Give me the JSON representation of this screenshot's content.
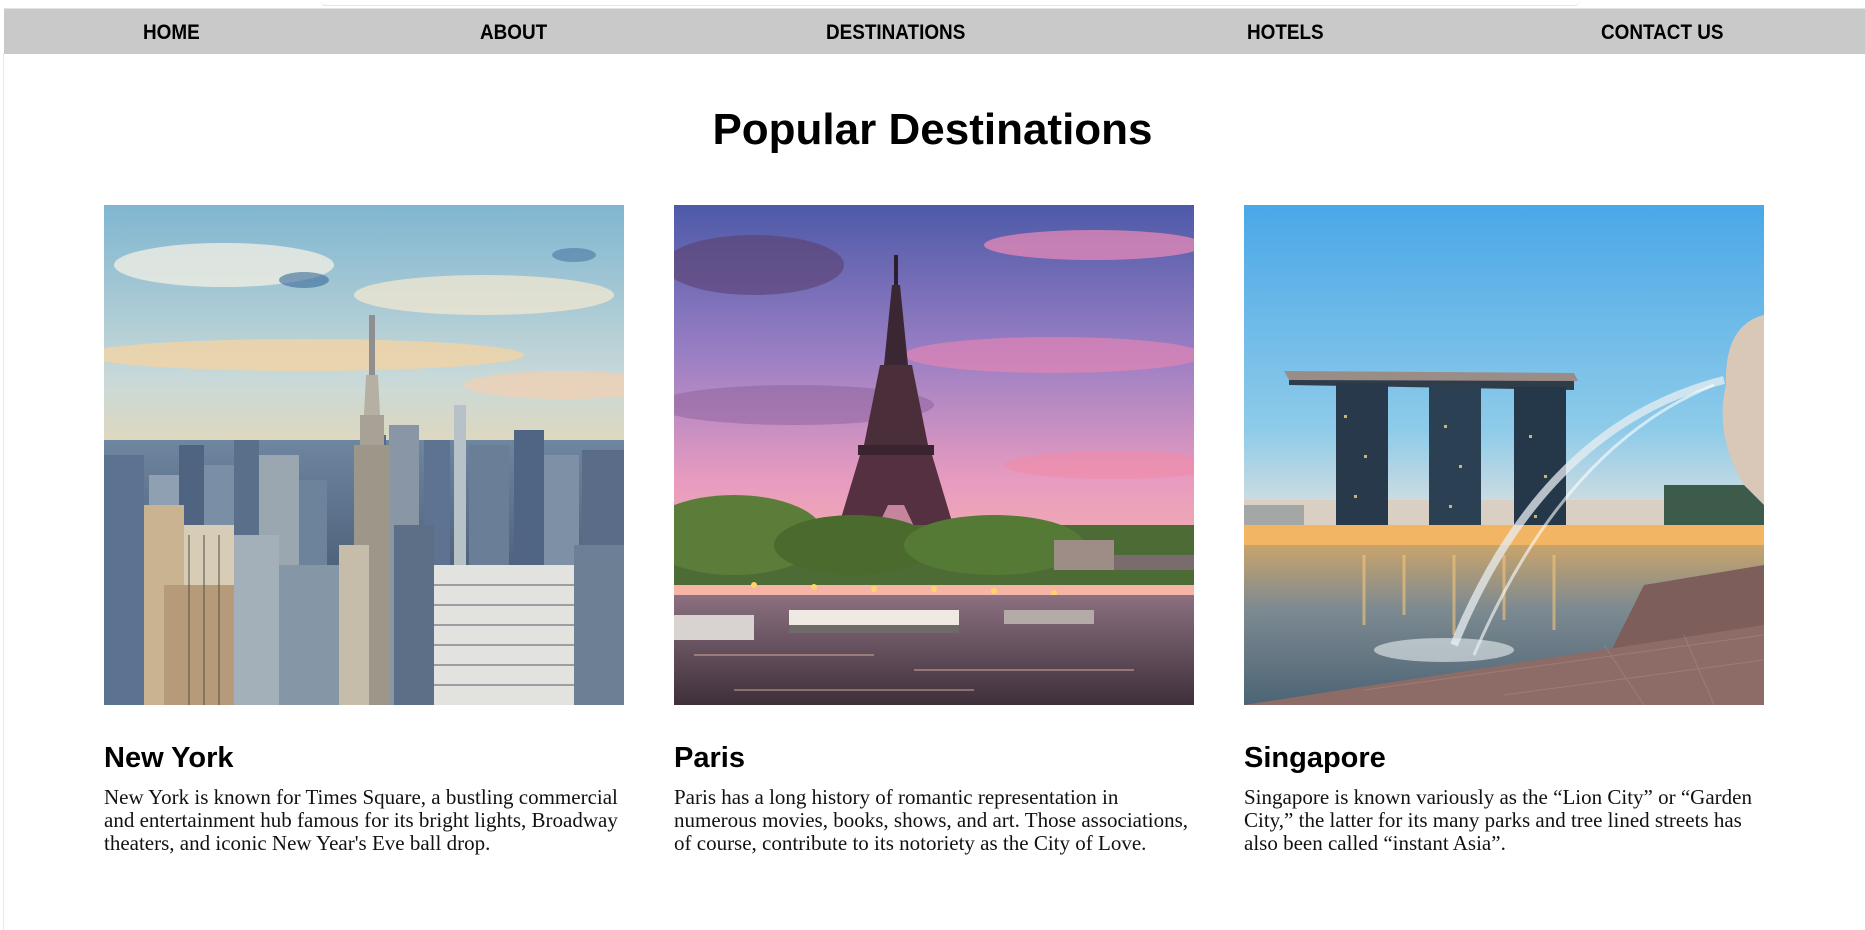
{
  "nav": {
    "items": [
      {
        "label": "HOME"
      },
      {
        "label": "ABOUT"
      },
      {
        "label": "DESTINATIONS"
      },
      {
        "label": "HOTELS"
      },
      {
        "label": "CONTACT US"
      }
    ]
  },
  "page": {
    "title": "Popular Destinations"
  },
  "destinations": [
    {
      "name": "New York",
      "description": "New York is known for Times Square, a bustling commercial and entertainment hub famous for its bright lights, Broadway theaters, and iconic New Year's Eve ball drop."
    },
    {
      "name": "Paris",
      "description": "Paris has a long history of romantic representation in numerous movies, books, shows, and art. Those associations, of course, contribute to its notoriety as the City of Love."
    },
    {
      "name": "Singapore",
      "description": "Singapore is known variously as the “Lion City” or “Garden City,” the latter for its many parks and tree lined streets has also been called “instant Asia”."
    }
  ],
  "colors": {
    "nav_background": "#c9c9c9",
    "text": "#000000"
  }
}
